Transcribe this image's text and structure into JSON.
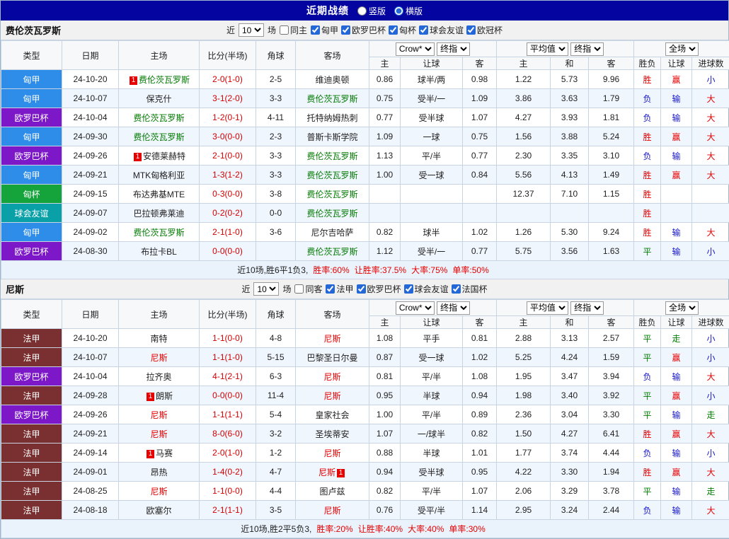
{
  "topbar": {
    "title": "近期战绩",
    "layout_options": [
      {
        "label": "竖版",
        "selected": false
      },
      {
        "label": "横版",
        "selected": true
      }
    ]
  },
  "table_head": {
    "type": "类型",
    "date": "日期",
    "home": "主场",
    "score": "比分(半场)",
    "corner": "角球",
    "away": "客场",
    "selects": {
      "odds": [
        "Crow*",
        "终指"
      ],
      "avg": [
        "平均值",
        "终指"
      ],
      "scope": "全场"
    },
    "sub": [
      "主",
      "让球",
      "客",
      "主",
      "和",
      "客",
      "胜负",
      "让球",
      "进球数"
    ]
  },
  "league_colors": {
    "匈甲": "#2e8de8",
    "欧罗巴杯": "#7d18c8",
    "匈杯": "#15a33c",
    "球会友谊": "#0aa0a8",
    "法甲": "#7a3030",
    "法国杯": "#2e8de8",
    "欧冠杯": "#7d18c8"
  },
  "team_colors": {
    "费伦茨瓦罗斯": "#007a00",
    "尼斯": "#e60000"
  },
  "result_colors": {
    "胜": "#e60000",
    "赢": "#e60000",
    "大": "#e60000",
    "负": "#1515cc",
    "输": "#1515cc",
    "小": "#1515cc",
    "平": "#008000",
    "走": "#008000"
  },
  "sections": [
    {
      "team": "费伦茨瓦罗斯",
      "filter": {
        "near_label": "近",
        "count": "10",
        "games_label": "场",
        "same_label": "同主",
        "same_checked": false,
        "leagues": [
          {
            "label": "匈甲",
            "checked": true
          },
          {
            "label": "欧罗巴杯",
            "checked": true
          },
          {
            "label": "匈杯",
            "checked": true
          },
          {
            "label": "球会友谊",
            "checked": true
          },
          {
            "label": "欧冠杯",
            "checked": true
          }
        ]
      },
      "rows": [
        {
          "type": "匈甲",
          "date": "24-10-20",
          "home": "费伦茨瓦罗斯",
          "home_badge": "1",
          "score": "2-0(1-0)",
          "corner": "2-5",
          "away": "维迪奥顿",
          "odds": [
            "0.86",
            "球半/两",
            "0.98"
          ],
          "avg": [
            "1.22",
            "5.73",
            "9.96"
          ],
          "res": [
            "胜",
            "赢",
            "小"
          ]
        },
        {
          "type": "匈甲",
          "date": "24-10-07",
          "home": "保克什",
          "score": "3-1(2-0)",
          "corner": "3-3",
          "away": "费伦茨瓦罗斯",
          "odds": [
            "0.75",
            "受半/一",
            "1.09"
          ],
          "avg": [
            "3.86",
            "3.63",
            "1.79"
          ],
          "res": [
            "负",
            "输",
            "大"
          ]
        },
        {
          "type": "欧罗巴杯",
          "date": "24-10-04",
          "home": "费伦茨瓦罗斯",
          "score": "1-2(0-1)",
          "corner": "4-11",
          "away": "托特纳姆热刺",
          "odds": [
            "0.77",
            "受半球",
            "1.07"
          ],
          "avg": [
            "4.27",
            "3.93",
            "1.81"
          ],
          "res": [
            "负",
            "输",
            "大"
          ]
        },
        {
          "type": "匈甲",
          "date": "24-09-30",
          "home": "费伦茨瓦罗斯",
          "score": "3-0(0-0)",
          "corner": "2-3",
          "away": "普斯卡斯学院",
          "odds": [
            "1.09",
            "一球",
            "0.75"
          ],
          "avg": [
            "1.56",
            "3.88",
            "5.24"
          ],
          "res": [
            "胜",
            "赢",
            "大"
          ]
        },
        {
          "type": "欧罗巴杯",
          "date": "24-09-26",
          "home": "安德莱赫特",
          "home_badge": "1",
          "score": "2-1(0-0)",
          "corner": "3-3",
          "away": "费伦茨瓦罗斯",
          "odds": [
            "1.13",
            "平/半",
            "0.77"
          ],
          "avg": [
            "2.30",
            "3.35",
            "3.10"
          ],
          "res": [
            "负",
            "输",
            "大"
          ]
        },
        {
          "type": "匈甲",
          "date": "24-09-21",
          "home": "MTK匈格利亚",
          "score": "1-3(1-2)",
          "corner": "3-3",
          "away": "费伦茨瓦罗斯",
          "odds": [
            "1.00",
            "受一球",
            "0.84"
          ],
          "avg": [
            "5.56",
            "4.13",
            "1.49"
          ],
          "res": [
            "胜",
            "赢",
            "大"
          ]
        },
        {
          "type": "匈杯",
          "date": "24-09-15",
          "home": "布达弗基MTE",
          "score": "0-3(0-0)",
          "corner": "3-8",
          "away": "费伦茨瓦罗斯",
          "odds": [
            "",
            "",
            ""
          ],
          "avg": [
            "12.37",
            "7.10",
            "1.15"
          ],
          "res": [
            "胜",
            "",
            ""
          ]
        },
        {
          "type": "球会友谊",
          "date": "24-09-07",
          "home": "巴拉顿弗莱迪",
          "score": "0-2(0-2)",
          "corner": "0-0",
          "away": "费伦茨瓦罗斯",
          "odds": [
            "",
            "",
            ""
          ],
          "avg": [
            "",
            "",
            ""
          ],
          "res": [
            "胜",
            "",
            ""
          ]
        },
        {
          "type": "匈甲",
          "date": "24-09-02",
          "home": "费伦茨瓦罗斯",
          "score": "2-1(1-0)",
          "corner": "3-6",
          "away": "尼尔吉哈萨",
          "odds": [
            "0.82",
            "球半",
            "1.02"
          ],
          "avg": [
            "1.26",
            "5.30",
            "9.24"
          ],
          "res": [
            "胜",
            "输",
            "大"
          ]
        },
        {
          "type": "欧罗巴杯",
          "date": "24-08-30",
          "home": "布拉卡BL",
          "score": "0-0(0-0)",
          "corner": "",
          "away": "费伦茨瓦罗斯",
          "odds": [
            "1.12",
            "受半/一",
            "0.77"
          ],
          "avg": [
            "5.75",
            "3.56",
            "1.63"
          ],
          "res": [
            "平",
            "输",
            "小"
          ]
        }
      ],
      "summary": [
        {
          "text": "近10场,胜6平1负3,",
          "color": "#222222"
        },
        {
          "text": "胜率:60%",
          "color": "#e60000"
        },
        {
          "text": "让胜率:37.5%",
          "color": "#e60000"
        },
        {
          "text": "大率:75%",
          "color": "#e60000"
        },
        {
          "text": "单率:50%",
          "color": "#e60000"
        }
      ]
    },
    {
      "team": "尼斯",
      "filter": {
        "near_label": "近",
        "count": "10",
        "games_label": "场",
        "same_label": "同客",
        "same_checked": false,
        "leagues": [
          {
            "label": "法甲",
            "checked": true
          },
          {
            "label": "欧罗巴杯",
            "checked": true
          },
          {
            "label": "球会友谊",
            "checked": true
          },
          {
            "label": "法国杯",
            "checked": true
          }
        ]
      },
      "rows": [
        {
          "type": "法甲",
          "date": "24-10-20",
          "home": "南特",
          "score": "1-1(0-0)",
          "corner": "4-8",
          "away": "尼斯",
          "odds": [
            "1.08",
            "平手",
            "0.81"
          ],
          "avg": [
            "2.88",
            "3.13",
            "2.57"
          ],
          "res": [
            "平",
            "走",
            "小"
          ]
        },
        {
          "type": "法甲",
          "date": "24-10-07",
          "home": "尼斯",
          "score": "1-1(1-0)",
          "corner": "5-15",
          "away": "巴黎圣日尔曼",
          "odds": [
            "0.87",
            "受一球",
            "1.02"
          ],
          "avg": [
            "5.25",
            "4.24",
            "1.59"
          ],
          "res": [
            "平",
            "赢",
            "小"
          ]
        },
        {
          "type": "欧罗巴杯",
          "date": "24-10-04",
          "home": "拉齐奥",
          "score": "4-1(2-1)",
          "corner": "6-3",
          "away": "尼斯",
          "odds": [
            "0.81",
            "平/半",
            "1.08"
          ],
          "avg": [
            "1.95",
            "3.47",
            "3.94"
          ],
          "res": [
            "负",
            "输",
            "大"
          ]
        },
        {
          "type": "法甲",
          "date": "24-09-28",
          "home": "朗斯",
          "home_badge": "1",
          "score": "0-0(0-0)",
          "corner": "11-4",
          "away": "尼斯",
          "odds": [
            "0.95",
            "半球",
            "0.94"
          ],
          "avg": [
            "1.98",
            "3.40",
            "3.92"
          ],
          "res": [
            "平",
            "赢",
            "小"
          ]
        },
        {
          "type": "欧罗巴杯",
          "date": "24-09-26",
          "home": "尼斯",
          "score": "1-1(1-1)",
          "corner": "5-4",
          "away": "皇家社会",
          "odds": [
            "1.00",
            "平/半",
            "0.89"
          ],
          "avg": [
            "2.36",
            "3.04",
            "3.30"
          ],
          "res": [
            "平",
            "输",
            "走"
          ]
        },
        {
          "type": "法甲",
          "date": "24-09-21",
          "home": "尼斯",
          "score": "8-0(6-0)",
          "corner": "3-2",
          "away": "圣埃蒂安",
          "odds": [
            "1.07",
            "一/球半",
            "0.82"
          ],
          "avg": [
            "1.50",
            "4.27",
            "6.41"
          ],
          "res": [
            "胜",
            "赢",
            "大"
          ]
        },
        {
          "type": "法甲",
          "date": "24-09-14",
          "home": "马赛",
          "home_badge": "1",
          "score": "2-0(1-0)",
          "corner": "1-2",
          "away": "尼斯",
          "odds": [
            "0.88",
            "半球",
            "1.01"
          ],
          "avg": [
            "1.77",
            "3.74",
            "4.44"
          ],
          "res": [
            "负",
            "输",
            "小"
          ]
        },
        {
          "type": "法甲",
          "date": "24-09-01",
          "home": "昂热",
          "score": "1-4(0-2)",
          "corner": "4-7",
          "away": "尼斯",
          "away_badge": "1",
          "odds": [
            "0.94",
            "受半球",
            "0.95"
          ],
          "avg": [
            "4.22",
            "3.30",
            "1.94"
          ],
          "res": [
            "胜",
            "赢",
            "大"
          ]
        },
        {
          "type": "法甲",
          "date": "24-08-25",
          "home": "尼斯",
          "score": "1-1(0-0)",
          "corner": "4-4",
          "away": "图卢兹",
          "odds": [
            "0.82",
            "平/半",
            "1.07"
          ],
          "avg": [
            "2.06",
            "3.29",
            "3.78"
          ],
          "res": [
            "平",
            "输",
            "走"
          ]
        },
        {
          "type": "法甲",
          "date": "24-08-18",
          "home": "欧塞尔",
          "score": "2-1(1-1)",
          "corner": "3-5",
          "away": "尼斯",
          "odds": [
            "0.76",
            "受平/半",
            "1.14"
          ],
          "avg": [
            "2.95",
            "3.24",
            "2.44"
          ],
          "res": [
            "负",
            "输",
            "大"
          ]
        }
      ],
      "summary": [
        {
          "text": "近10场,胜2平5负3,",
          "color": "#222222"
        },
        {
          "text": "胜率:20%",
          "color": "#e60000"
        },
        {
          "text": "让胜率:40%",
          "color": "#e60000"
        },
        {
          "text": "大率:40%",
          "color": "#e60000"
        },
        {
          "text": "单率:30%",
          "color": "#e60000"
        }
      ]
    }
  ]
}
